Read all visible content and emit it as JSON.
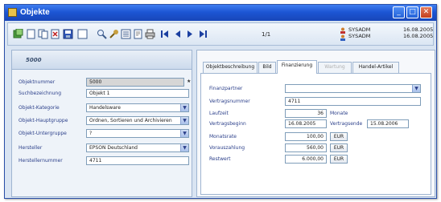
{
  "window": {
    "title": "Objekte",
    "minimize_glyph": "_",
    "maximize_glyph": "□",
    "close_glyph": "✕"
  },
  "toolbar": {
    "record_count": "1/1",
    "users": [
      {
        "name": "SYSADM",
        "date": "16.08.2005"
      },
      {
        "name": "SYSADM",
        "date": "16.08.2005"
      }
    ]
  },
  "left": {
    "header_title": "5000",
    "fields": {
      "objektnummer": {
        "label": "Objektnummer",
        "value": "5000",
        "marker": "★"
      },
      "suchbezeichnung": {
        "label": "Suchbezeichnung",
        "value": "Objekt 1"
      },
      "objekt_kategorie": {
        "label": "Objekt-Kategorie",
        "value": "Handelsware"
      },
      "objekt_hauptgruppe": {
        "label": "Objekt-Hauptgruppe",
        "value": "Ordnen, Sortieren und Archivieren"
      },
      "objekt_untergruppe": {
        "label": "Objekt-Untergruppe",
        "value": "?"
      },
      "hersteller": {
        "label": "Hersteller",
        "value": "EPSON Deutschland"
      },
      "herstellernummer": {
        "label": "Herstellernummer",
        "value": "4711"
      }
    }
  },
  "tabs": [
    {
      "label": "Objektbeschreibung",
      "state": "normal"
    },
    {
      "label": "Bild",
      "state": "normal"
    },
    {
      "label": "Finanzierung",
      "state": "active"
    },
    {
      "label": "Wartung",
      "state": "disabled"
    },
    {
      "label": "Handel-Artikel",
      "state": "normal"
    }
  ],
  "finanzierung": {
    "finanzpartner": {
      "label": "Finanzpartner",
      "value": ""
    },
    "vertragsnummer": {
      "label": "Vertragsnummer",
      "value": "4711"
    },
    "laufzeit": {
      "label": "Laufzeit",
      "value": "36",
      "unit": "Monate"
    },
    "vertragsbeginn": {
      "label": "Vertragsbeginn",
      "value": "16.08.2005"
    },
    "vertragsende": {
      "label": "Vertragsende",
      "value": "15.08.2006"
    },
    "monatsrate": {
      "label": "Monatsrate",
      "value": "100,00",
      "currency": "EUR"
    },
    "vorauszahlung": {
      "label": "Vorauszahlung",
      "value": "560,00",
      "currency": "EUR"
    },
    "restwert": {
      "label": "Restwert",
      "value": "6.000,00",
      "currency": "EUR"
    }
  },
  "icons": {
    "toolbar": [
      "new-record-icon",
      "new-page-icon",
      "copy-icon",
      "delete-icon",
      "save-icon",
      "blank-icon",
      "search-icon",
      "tools-icon",
      "list-icon",
      "report-icon",
      "print-icon",
      "first-record-icon",
      "previous-record-icon",
      "next-record-icon",
      "last-record-icon"
    ]
  },
  "colors": {
    "titlebar": "#1c56d4",
    "label_text": "#2b3f8a",
    "panel_border": "#9fb5d1",
    "nav_arrows": "#1b3fa0"
  }
}
